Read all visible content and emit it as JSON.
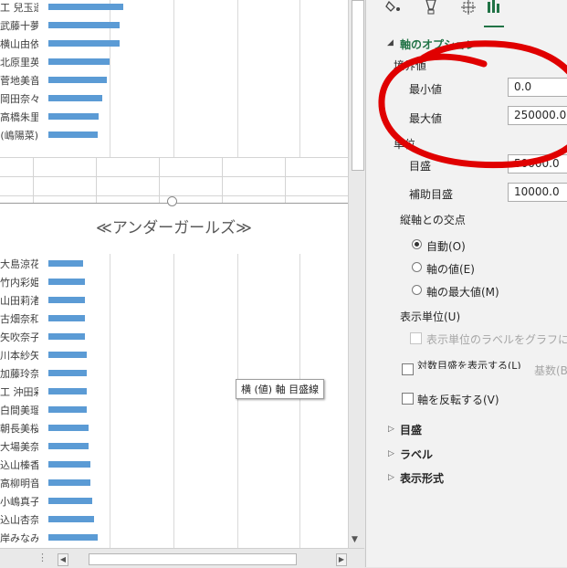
{
  "top_chart": {
    "labels": [
      "工 兒玉遥",
      "武藤十夢",
      "横山由依",
      "北原里英",
      "菅地美音",
      "岡田奈々",
      "高橋朱里",
      "(嶋陽菜)"
    ],
    "values": [
      82,
      78,
      78,
      67,
      64,
      59,
      55,
      54
    ]
  },
  "bottom_chart": {
    "title": "≪アンダーガールズ≫",
    "labels": [
      "大島涼花",
      "竹内彩姫",
      "山田莉渚",
      "古畑奈和",
      "矢吹奈子",
      "川本紗矢",
      "加藤玲奈",
      "工 沖田彩",
      "白間美瑠",
      "朝長美桜",
      "大場美奈",
      "込山榛香",
      "高柳明音",
      "小嶋真子",
      "込山杏奈",
      "岸みなみ"
    ],
    "values": [
      38,
      40,
      40,
      40,
      40,
      42,
      42,
      42,
      42,
      44,
      44,
      46,
      46,
      48,
      50,
      54
    ]
  },
  "tooltip": "横 (値) 軸 目盛線",
  "pane": {
    "section_title": "軸のオプション",
    "bounds_label": "境界値",
    "min_label": "最小値",
    "min_value": "0.0",
    "max_label": "最大値",
    "max_value": "250000.0",
    "units_label": "単位",
    "major_label": "目盛",
    "major_value": "50000.0",
    "minor_label": "補助目盛",
    "minor_value": "10000.0",
    "cross_label": "縦軸との交点",
    "radio_auto": "自動(O)",
    "radio_value": "軸の値(E)",
    "radio_max": "軸の最大値(M)",
    "display_units_label": "表示単位(U)",
    "show_units_label": "表示単位のラベルをグラフに表示す",
    "log_scale_label": "対数目盛を表示する(L)",
    "log_base_label": "基数(B",
    "reverse_label": "軸を反転する(V)",
    "tick_marks": "目盛",
    "labels_section": "ラベル",
    "number_format": "表示形式"
  },
  "colors": {
    "bar": "#5b9bd5",
    "accent": "#217346",
    "annotation": "#e00000"
  }
}
